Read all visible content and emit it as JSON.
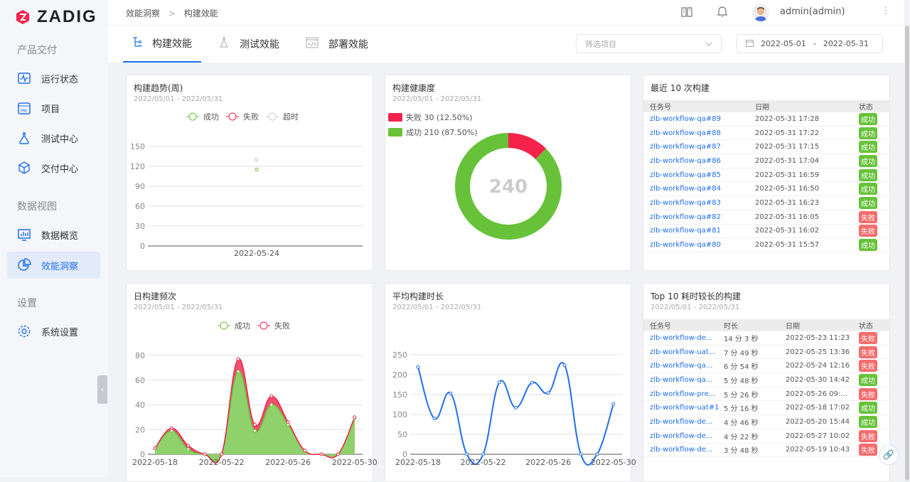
{
  "brand": {
    "name": "ZADIG",
    "color": "#f5224b"
  },
  "sidebar": {
    "sections": [
      {
        "label": "产品交付"
      },
      {
        "label": "数据视图"
      },
      {
        "label": "设置"
      }
    ],
    "items": [
      {
        "label": "运行状态",
        "icon": "pulse-icon"
      },
      {
        "label": "项目",
        "icon": "project-icon"
      },
      {
        "label": "测试中心",
        "icon": "flask-icon"
      },
      {
        "label": "交付中心",
        "icon": "package-icon"
      },
      {
        "label": "数据概览",
        "icon": "dashboard-icon"
      },
      {
        "label": "效能洞察",
        "icon": "pie-chart-icon",
        "active": true
      },
      {
        "label": "系统设置",
        "icon": "gear-icon"
      }
    ]
  },
  "header": {
    "breadcrumb": [
      "效能洞察",
      "构建效能"
    ],
    "separator": ">",
    "user": "admin(admin)"
  },
  "tabs": [
    {
      "label": "构建效能",
      "active": true
    },
    {
      "label": "测试效能"
    },
    {
      "label": "部署效能"
    }
  ],
  "filters": {
    "project_placeholder": "筛选项目",
    "date_start": "2022-05-01",
    "date_sep": "-",
    "date_end": "2022-05-31"
  },
  "colors": {
    "accent": "#1f6feb",
    "success": "#67c23a",
    "fail": "#f5224b",
    "timeout": "#cccccc"
  },
  "cards": {
    "trend": {
      "title": "构建趋势(周)",
      "range": "2022/05/01 - 2022/05/31",
      "legend": [
        "成功",
        "失败",
        "超时"
      ]
    },
    "health": {
      "title": "构建健康度",
      "range": "2022/05/01 - 2022/05/31",
      "legend": [
        "失败 30 (12.50%)",
        "成功 210 (87.50%)"
      ],
      "total": "240"
    },
    "recent": {
      "title": "最近 10 次构建",
      "headers": [
        "任务号",
        "日期",
        "状态"
      ],
      "rows": [
        [
          "zlb-workflow-qa#89",
          "2022-05-31 17:28",
          "成功"
        ],
        [
          "zlb-workflow-qa#88",
          "2022-05-31 17:22",
          "成功"
        ],
        [
          "zlb-workflow-qa#87",
          "2022-05-31 17:15",
          "成功"
        ],
        [
          "zlb-workflow-qa#86",
          "2022-05-31 17:04",
          "成功"
        ],
        [
          "zlb-workflow-qa#85",
          "2022-05-31 16:59",
          "成功"
        ],
        [
          "zlb-workflow-qa#84",
          "2022-05-31 16:50",
          "成功"
        ],
        [
          "zlb-workflow-qa#83",
          "2022-05-31 16:23",
          "成功"
        ],
        [
          "zlb-workflow-qa#82",
          "2022-05-31 16:05",
          "失败"
        ],
        [
          "zlb-workflow-qa#81",
          "2022-05-31 16:02",
          "失败"
        ],
        [
          "zlb-workflow-qa#80",
          "2022-05-31 15:57",
          "成功"
        ]
      ]
    },
    "daily": {
      "title": "日构建频次",
      "range": "2022/05/01 - 2022/05/31",
      "legend": [
        "成功",
        "失败"
      ]
    },
    "avg": {
      "title": "平均构建时长",
      "range": "2022/05/01 - 2022/05/31"
    },
    "top10": {
      "title": "Top 10 耗时较长的构建",
      "range": "2022/05/01 - 2022/05/31",
      "headers": [
        "任务号",
        "时长",
        "日期",
        "状态"
      ],
      "rows": [
        [
          "zlb-workflow-de...",
          "14 分 3 秒",
          "2022-05-23 11:23",
          "失败"
        ],
        [
          "zlb-workflow-uat...",
          "7 分 49 秒",
          "2022-05-25 13:36",
          "失败"
        ],
        [
          "zlb-workflow-qa...",
          "6 分 54 秒",
          "2022-05-24 12:16",
          "失败"
        ],
        [
          "zlb-workflow-qa...",
          "5 分 48 秒",
          "2022-05-30 14:42",
          "成功"
        ],
        [
          "zlb-workflow-pre...",
          "5 分 26 秒",
          "2022-05-26 09:...",
          "失败"
        ],
        [
          "zlb-workflow-uat#1",
          "5 分 16 秒",
          "2022-05-18 17:02",
          "成功"
        ],
        [
          "zlb-workflow-de...",
          "4 分 46 秒",
          "2022-05-20 15:44",
          "成功"
        ],
        [
          "zlb-workflow-de...",
          "4 分 22 秒",
          "2022-05-27 10:02",
          "失败"
        ],
        [
          "zlb-workflow-de...",
          "3 分 48 秒",
          "2022-05-19 10:43",
          "失败"
        ]
      ]
    }
  },
  "chart_data": [
    {
      "type": "scatter",
      "title": "构建趋势(周)",
      "categories": [
        "2022-05-24"
      ],
      "ylim": [
        0,
        150
      ],
      "yticks": [
        0,
        30,
        60,
        90,
        120,
        150
      ],
      "series": [
        {
          "name": "成功",
          "values": [
            115
          ]
        },
        {
          "name": "失败",
          "values": [
            130
          ]
        },
        {
          "name": "超时",
          "values": []
        }
      ],
      "grid": true,
      "legend": "top"
    },
    {
      "type": "pie",
      "title": "构建健康度",
      "donut": true,
      "slices": [
        {
          "name": "失败",
          "value": 30,
          "percent": 12.5
        },
        {
          "name": "成功",
          "value": 210,
          "percent": 87.5
        }
      ],
      "center_label": "240",
      "legend": "top-left"
    },
    {
      "type": "area",
      "stacked": true,
      "title": "日构建频次",
      "x": [
        "2022-05-18",
        "2022-05-19",
        "2022-05-20",
        "2022-05-21",
        "2022-05-22",
        "2022-05-23",
        "2022-05-24",
        "2022-05-25",
        "2022-05-26",
        "2022-05-27",
        "2022-05-28",
        "2022-05-29",
        "2022-05-30"
      ],
      "xticks": [
        "2022-05-18",
        "2022-05-22",
        "2022-05-26",
        "2022-05-30"
      ],
      "ylim": [
        0,
        80
      ],
      "yticks": [
        0,
        20,
        40,
        60,
        80
      ],
      "series": [
        {
          "name": "成功",
          "values": [
            5,
            19,
            4,
            0,
            0,
            67,
            19,
            40,
            24,
            3,
            0,
            0,
            29
          ]
        },
        {
          "name": "失败",
          "values": [
            0,
            2,
            3,
            0,
            0,
            10,
            5,
            7,
            2,
            0,
            0,
            0,
            1
          ]
        }
      ],
      "grid": true,
      "legend": "top"
    },
    {
      "type": "line",
      "title": "平均构建时长",
      "x": [
        "2022-05-18",
        "2022-05-19",
        "2022-05-20",
        "2022-05-21",
        "2022-05-22",
        "2022-05-23",
        "2022-05-24",
        "2022-05-25",
        "2022-05-26",
        "2022-05-27",
        "2022-05-28",
        "2022-05-29",
        "2022-05-30"
      ],
      "xticks": [
        "2022-05-18",
        "2022-05-22",
        "2022-05-26",
        "2022-05-30"
      ],
      "ylim": [
        0,
        250
      ],
      "yticks": [
        0,
        50,
        100,
        150,
        200,
        250
      ],
      "series": [
        {
          "values": [
            219,
            90,
            153,
            0,
            0,
            181,
            117,
            180,
            154,
            224,
            0,
            0,
            126
          ]
        }
      ],
      "grid": true
    }
  ]
}
